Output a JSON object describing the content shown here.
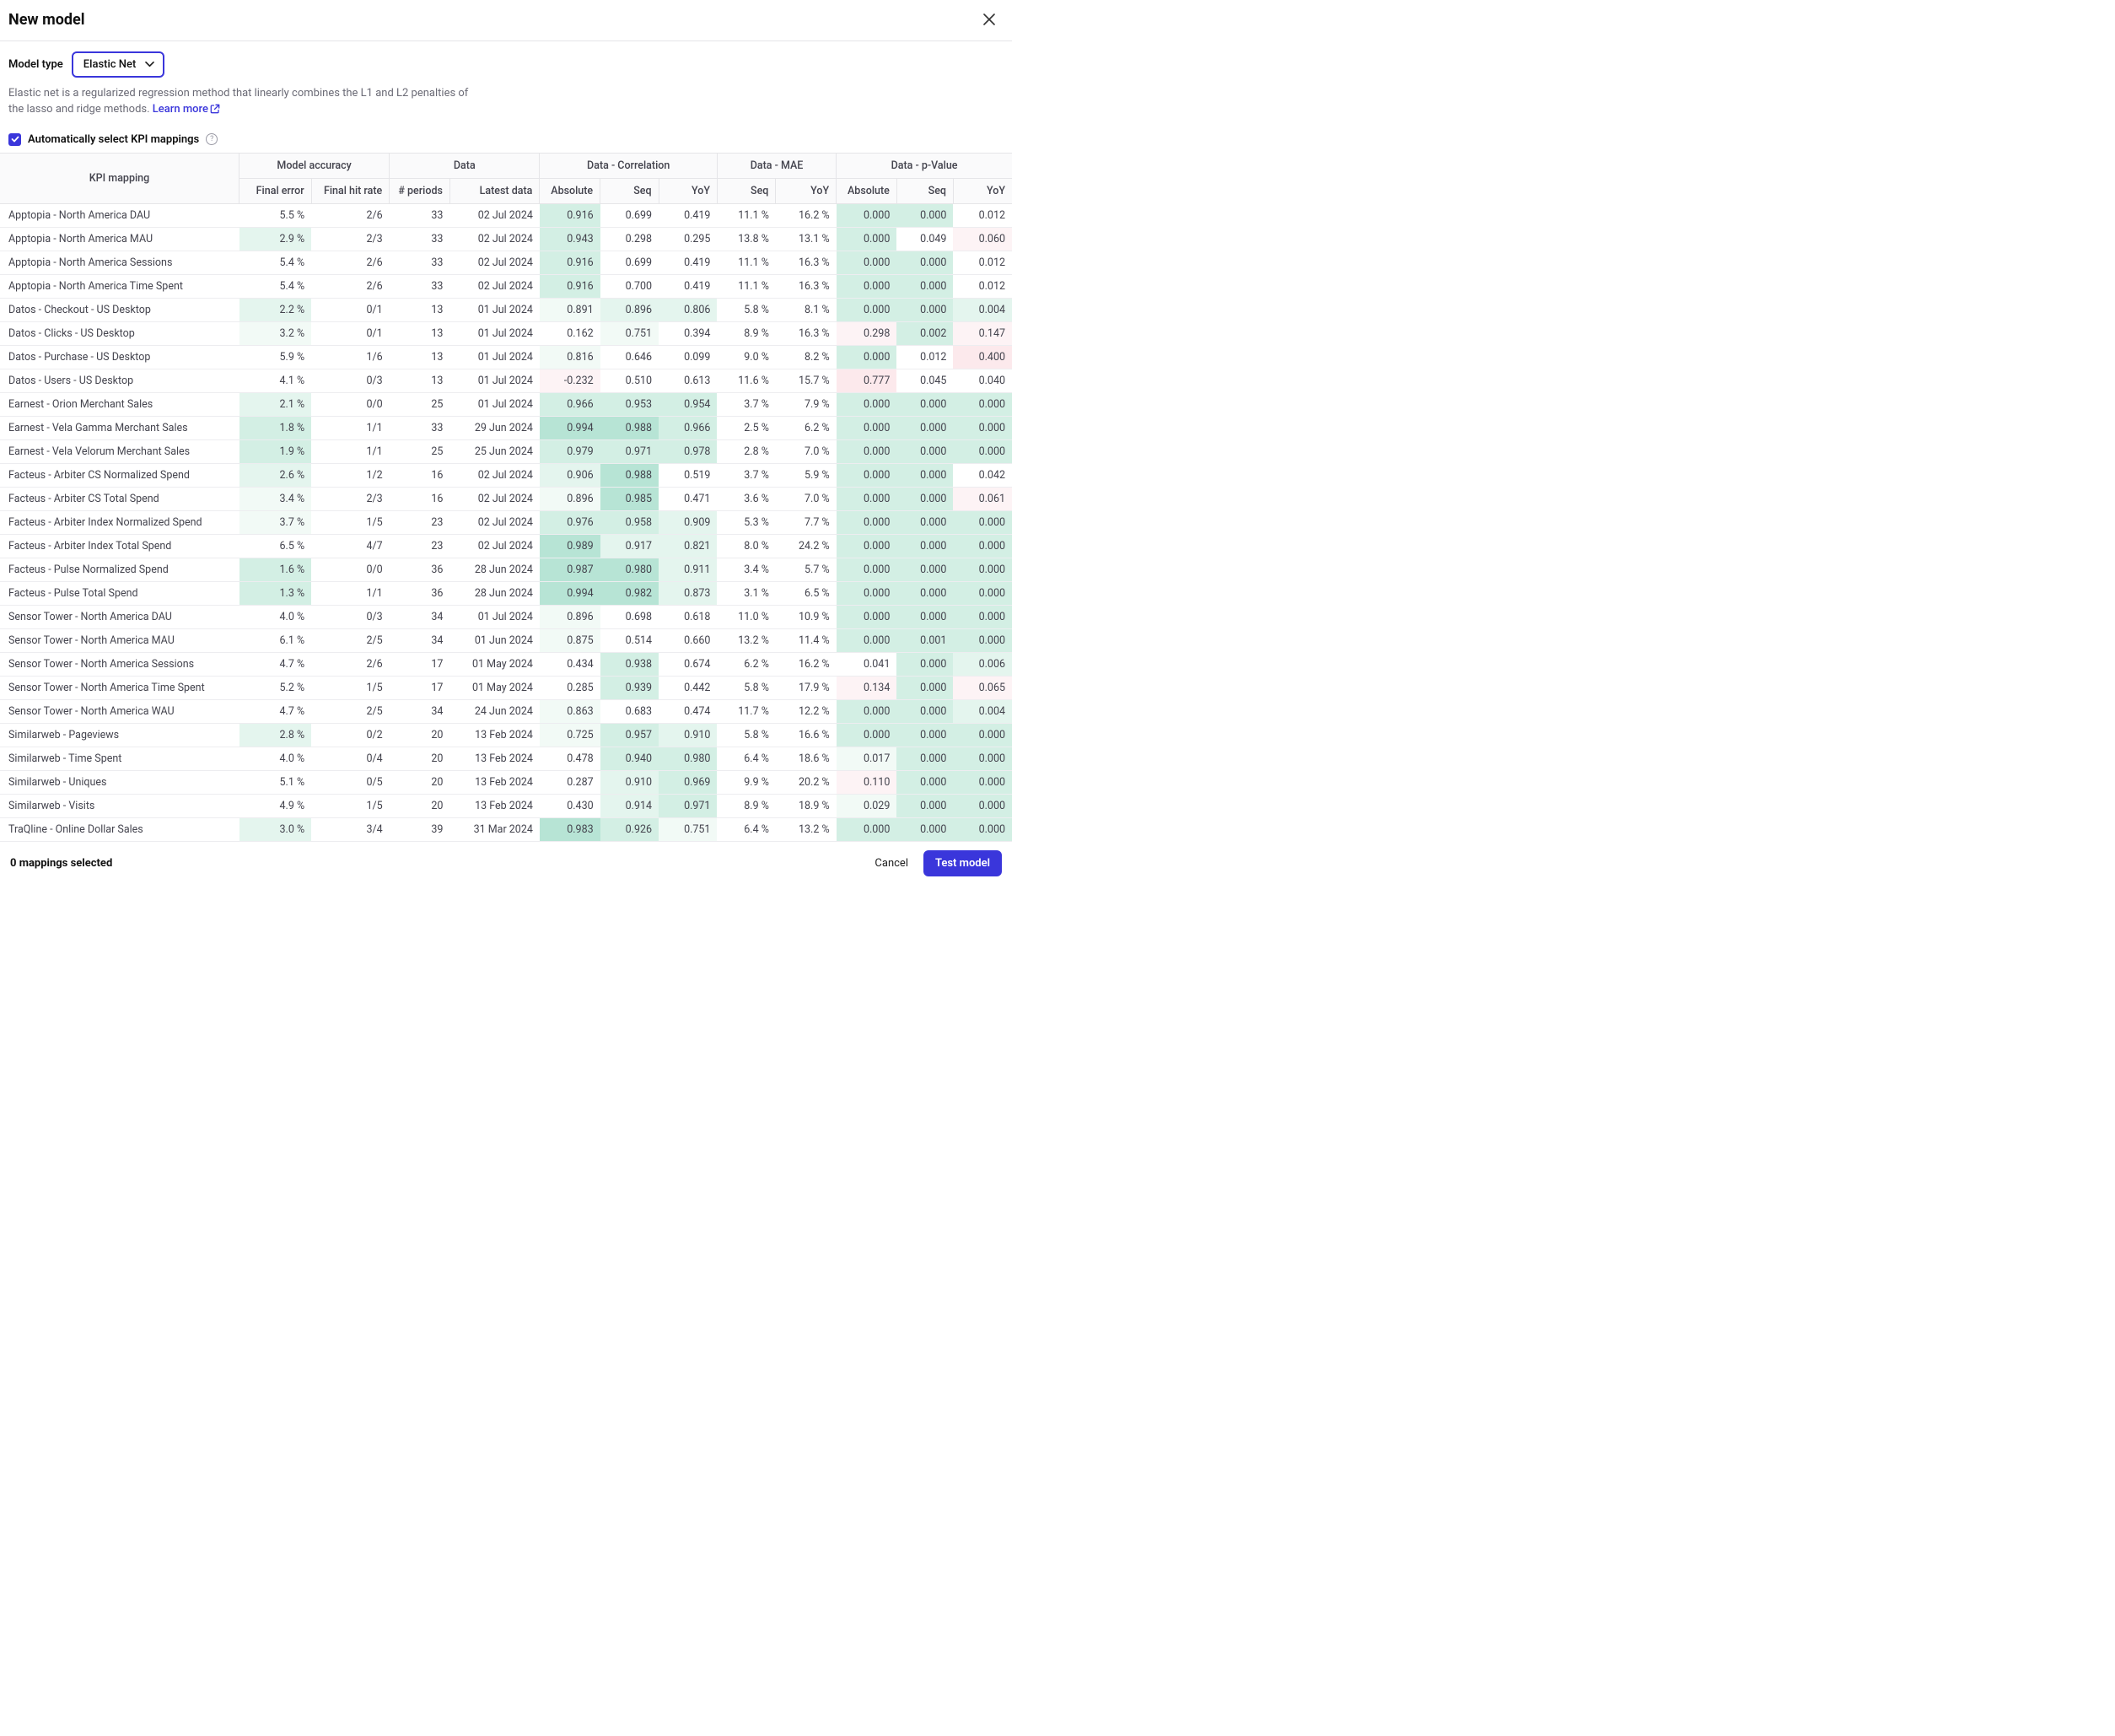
{
  "header": {
    "title": "New model"
  },
  "config": {
    "modeltype_label": "Model type",
    "modeltype_value": "Elastic Net",
    "description_prefix": "Elastic net is a regularized regression method that linearly combines the L1 and L2 penalties of the lasso and ridge methods. ",
    "learnmore": "Learn more",
    "auto_kpi_label": "Automatically select KPI mappings",
    "auto_kpi_checked": true
  },
  "table": {
    "groups": {
      "accuracy": "Model accuracy",
      "data": "Data",
      "corr": "Data - Correlation",
      "mae": "Data - MAE",
      "pval": "Data - p-Value"
    },
    "cols": {
      "kpi": "KPI mapping",
      "final_error": "Final error",
      "final_hit_rate": "Final hit rate",
      "n_periods": "# periods",
      "latest_data": "Latest data",
      "c_abs": "Absolute",
      "c_seq": "Seq",
      "c_yoy": "YoY",
      "m_seq": "Seq",
      "m_yoy": "YoY",
      "p_abs": "Absolute",
      "p_seq": "Seq",
      "p_yoy": "YoY"
    },
    "rows": [
      {
        "kpi": "Apptopia - North America DAU",
        "fe": "5.5 %",
        "fe_c": "",
        "fhr": "2/6",
        "np": "33",
        "ld": "02 Jul 2024",
        "ca": "0.916",
        "ca_c": "g3",
        "cs": "0.699",
        "cs_c": "",
        "cy": "0.419",
        "cy_c": "",
        "ms": "11.1 %",
        "my": "16.2 %",
        "pa": "0.000",
        "pa_c": "g3",
        "ps": "0.000",
        "ps_c": "g3",
        "py": "0.012",
        "py_c": ""
      },
      {
        "kpi": "Apptopia - North America MAU",
        "fe": "2.9 %",
        "fe_c": "g2",
        "fhr": "2/3",
        "np": "33",
        "ld": "02 Jul 2024",
        "ca": "0.943",
        "ca_c": "g3",
        "cs": "0.298",
        "cs_c": "",
        "cy": "0.295",
        "cy_c": "",
        "ms": "13.8 %",
        "my": "13.1 %",
        "pa": "0.000",
        "pa_c": "g3",
        "ps": "0.049",
        "ps_c": "",
        "py": "0.060",
        "py_c": "r1"
      },
      {
        "kpi": "Apptopia - North America Sessions",
        "fe": "5.4 %",
        "fe_c": "",
        "fhr": "2/6",
        "np": "33",
        "ld": "02 Jul 2024",
        "ca": "0.916",
        "ca_c": "g3",
        "cs": "0.699",
        "cs_c": "",
        "cy": "0.419",
        "cy_c": "",
        "ms": "11.1 %",
        "my": "16.3 %",
        "pa": "0.000",
        "pa_c": "g3",
        "ps": "0.000",
        "ps_c": "g3",
        "py": "0.012",
        "py_c": ""
      },
      {
        "kpi": "Apptopia - North America Time Spent",
        "fe": "5.4 %",
        "fe_c": "",
        "fhr": "2/6",
        "np": "33",
        "ld": "02 Jul 2024",
        "ca": "0.916",
        "ca_c": "g3",
        "cs": "0.700",
        "cs_c": "",
        "cy": "0.419",
        "cy_c": "",
        "ms": "11.1 %",
        "my": "16.3 %",
        "pa": "0.000",
        "pa_c": "g3",
        "ps": "0.000",
        "ps_c": "g3",
        "py": "0.012",
        "py_c": ""
      },
      {
        "kpi": "Datos - Checkout - US Desktop",
        "fe": "2.2 %",
        "fe_c": "g2",
        "fhr": "0/1",
        "np": "13",
        "ld": "01 Jul 2024",
        "ca": "0.891",
        "ca_c": "g1",
        "cs": "0.896",
        "cs_c": "g2",
        "cy": "0.806",
        "cy_c": "g2",
        "ms": "5.8 %",
        "my": "8.1 %",
        "pa": "0.000",
        "pa_c": "g3",
        "ps": "0.000",
        "ps_c": "g3",
        "py": "0.004",
        "py_c": "g2"
      },
      {
        "kpi": "Datos - Clicks - US Desktop",
        "fe": "3.2 %",
        "fe_c": "g1",
        "fhr": "0/1",
        "np": "13",
        "ld": "01 Jul 2024",
        "ca": "0.162",
        "ca_c": "",
        "cs": "0.751",
        "cs_c": "g1",
        "cy": "0.394",
        "cy_c": "",
        "ms": "8.9 %",
        "my": "16.3 %",
        "pa": "0.298",
        "pa_c": "r1",
        "ps": "0.002",
        "ps_c": "g3",
        "py": "0.147",
        "py_c": "r1"
      },
      {
        "kpi": "Datos - Purchase - US Desktop",
        "fe": "5.9 %",
        "fe_c": "",
        "fhr": "1/6",
        "np": "13",
        "ld": "01 Jul 2024",
        "ca": "0.816",
        "ca_c": "g1",
        "cs": "0.646",
        "cs_c": "",
        "cy": "0.099",
        "cy_c": "",
        "ms": "9.0 %",
        "my": "8.2 %",
        "pa": "0.000",
        "pa_c": "g3",
        "ps": "0.012",
        "ps_c": "",
        "py": "0.400",
        "py_c": "r2"
      },
      {
        "kpi": "Datos - Users - US Desktop",
        "fe": "4.1 %",
        "fe_c": "",
        "fhr": "0/3",
        "np": "13",
        "ld": "01 Jul 2024",
        "ca": "-0.232",
        "ca_c": "r1",
        "cs": "0.510",
        "cs_c": "",
        "cy": "0.613",
        "cy_c": "",
        "ms": "11.6 %",
        "my": "15.7 %",
        "pa": "0.777",
        "pa_c": "r2",
        "ps": "0.045",
        "ps_c": "",
        "py": "0.040",
        "py_c": ""
      },
      {
        "kpi": "Earnest - Orion Merchant Sales",
        "fe": "2.1 %",
        "fe_c": "g2",
        "fhr": "0/0",
        "np": "25",
        "ld": "01 Jul 2024",
        "ca": "0.966",
        "ca_c": "g3",
        "cs": "0.953",
        "cs_c": "g3",
        "cy": "0.954",
        "cy_c": "g3",
        "ms": "3.7 %",
        "my": "7.9 %",
        "pa": "0.000",
        "pa_c": "g3",
        "ps": "0.000",
        "ps_c": "g3",
        "py": "0.000",
        "py_c": "g3"
      },
      {
        "kpi": "Earnest - Vela Gamma Merchant Sales",
        "fe": "1.8 %",
        "fe_c": "g3",
        "fhr": "1/1",
        "np": "33",
        "ld": "29 Jun 2024",
        "ca": "0.994",
        "ca_c": "g5",
        "cs": "0.988",
        "cs_c": "g5",
        "cy": "0.966",
        "cy_c": "g3",
        "ms": "2.5 %",
        "my": "6.2 %",
        "pa": "0.000",
        "pa_c": "g3",
        "ps": "0.000",
        "ps_c": "g3",
        "py": "0.000",
        "py_c": "g3"
      },
      {
        "kpi": "Earnest - Vela Velorum Merchant Sales",
        "fe": "1.9 %",
        "fe_c": "g3",
        "fhr": "1/1",
        "np": "25",
        "ld": "25 Jun 2024",
        "ca": "0.979",
        "ca_c": "g3",
        "cs": "0.971",
        "cs_c": "g3",
        "cy": "0.978",
        "cy_c": "g3",
        "ms": "2.8 %",
        "my": "7.0 %",
        "pa": "0.000",
        "pa_c": "g3",
        "ps": "0.000",
        "ps_c": "g3",
        "py": "0.000",
        "py_c": "g3"
      },
      {
        "kpi": "Facteus - Arbiter CS Normalized Spend",
        "fe": "2.6 %",
        "fe_c": "g2",
        "fhr": "1/2",
        "np": "16",
        "ld": "02 Jul 2024",
        "ca": "0.906",
        "ca_c": "g2",
        "cs": "0.988",
        "cs_c": "g5",
        "cy": "0.519",
        "cy_c": "",
        "ms": "3.7 %",
        "my": "5.9 %",
        "pa": "0.000",
        "pa_c": "g3",
        "ps": "0.000",
        "ps_c": "g3",
        "py": "0.042",
        "py_c": ""
      },
      {
        "kpi": "Facteus - Arbiter CS Total Spend",
        "fe": "3.4 %",
        "fe_c": "g1",
        "fhr": "2/3",
        "np": "16",
        "ld": "02 Jul 2024",
        "ca": "0.896",
        "ca_c": "g1",
        "cs": "0.985",
        "cs_c": "g5",
        "cy": "0.471",
        "cy_c": "",
        "ms": "3.6 %",
        "my": "7.0 %",
        "pa": "0.000",
        "pa_c": "g3",
        "ps": "0.000",
        "ps_c": "g3",
        "py": "0.061",
        "py_c": "r1"
      },
      {
        "kpi": "Facteus - Arbiter Index Normalized Spend",
        "fe": "3.7 %",
        "fe_c": "g1",
        "fhr": "1/5",
        "np": "23",
        "ld": "02 Jul 2024",
        "ca": "0.976",
        "ca_c": "g3",
        "cs": "0.958",
        "cs_c": "g3",
        "cy": "0.909",
        "cy_c": "g2",
        "ms": "5.3 %",
        "my": "7.7 %",
        "pa": "0.000",
        "pa_c": "g3",
        "ps": "0.000",
        "ps_c": "g3",
        "py": "0.000",
        "py_c": "g3"
      },
      {
        "kpi": "Facteus - Arbiter Index Total Spend",
        "fe": "6.5 %",
        "fe_c": "",
        "fhr": "4/7",
        "np": "23",
        "ld": "02 Jul 2024",
        "ca": "0.989",
        "ca_c": "g5",
        "cs": "0.917",
        "cs_c": "g2",
        "cy": "0.821",
        "cy_c": "g2",
        "ms": "8.0 %",
        "my": "24.2 %",
        "pa": "0.000",
        "pa_c": "g3",
        "ps": "0.000",
        "ps_c": "g3",
        "py": "0.000",
        "py_c": "g3"
      },
      {
        "kpi": "Facteus - Pulse Normalized Spend",
        "fe": "1.6 %",
        "fe_c": "g3",
        "fhr": "0/0",
        "np": "36",
        "ld": "28 Jun 2024",
        "ca": "0.987",
        "ca_c": "g5",
        "cs": "0.980",
        "cs_c": "g5",
        "cy": "0.911",
        "cy_c": "g2",
        "ms": "3.4 %",
        "my": "5.7 %",
        "pa": "0.000",
        "pa_c": "g3",
        "ps": "0.000",
        "ps_c": "g3",
        "py": "0.000",
        "py_c": "g3"
      },
      {
        "kpi": "Facteus - Pulse Total Spend",
        "fe": "1.3 %",
        "fe_c": "g3",
        "fhr": "1/1",
        "np": "36",
        "ld": "28 Jun 2024",
        "ca": "0.994",
        "ca_c": "g5",
        "cs": "0.982",
        "cs_c": "g5",
        "cy": "0.873",
        "cy_c": "g2",
        "ms": "3.1 %",
        "my": "6.5 %",
        "pa": "0.000",
        "pa_c": "g3",
        "ps": "0.000",
        "ps_c": "g3",
        "py": "0.000",
        "py_c": "g3"
      },
      {
        "kpi": "Sensor Tower - North America DAU",
        "fe": "4.0 %",
        "fe_c": "",
        "fhr": "0/3",
        "np": "34",
        "ld": "01 Jul 2024",
        "ca": "0.896",
        "ca_c": "g1",
        "cs": "0.698",
        "cs_c": "",
        "cy": "0.618",
        "cy_c": "",
        "ms": "11.0 %",
        "my": "10.9 %",
        "pa": "0.000",
        "pa_c": "g3",
        "ps": "0.000",
        "ps_c": "g3",
        "py": "0.000",
        "py_c": "g3"
      },
      {
        "kpi": "Sensor Tower - North America MAU",
        "fe": "6.1 %",
        "fe_c": "",
        "fhr": "2/5",
        "np": "34",
        "ld": "01 Jun 2024",
        "ca": "0.875",
        "ca_c": "g1",
        "cs": "0.514",
        "cs_c": "",
        "cy": "0.660",
        "cy_c": "",
        "ms": "13.2 %",
        "my": "11.4 %",
        "pa": "0.000",
        "pa_c": "g3",
        "ps": "0.001",
        "ps_c": "g3",
        "py": "0.000",
        "py_c": "g3"
      },
      {
        "kpi": "Sensor Tower - North America Sessions",
        "fe": "4.7 %",
        "fe_c": "",
        "fhr": "2/6",
        "np": "17",
        "ld": "01 May 2024",
        "ca": "0.434",
        "ca_c": "",
        "cs": "0.938",
        "cs_c": "g3",
        "cy": "0.674",
        "cy_c": "",
        "ms": "6.2 %",
        "my": "16.2 %",
        "pa": "0.041",
        "pa_c": "",
        "ps": "0.000",
        "ps_c": "g3",
        "py": "0.006",
        "py_c": "g2"
      },
      {
        "kpi": "Sensor Tower - North America Time Spent",
        "fe": "5.2 %",
        "fe_c": "",
        "fhr": "1/5",
        "np": "17",
        "ld": "01 May 2024",
        "ca": "0.285",
        "ca_c": "",
        "cs": "0.939",
        "cs_c": "g3",
        "cy": "0.442",
        "cy_c": "",
        "ms": "5.8 %",
        "my": "17.9 %",
        "pa": "0.134",
        "pa_c": "r1",
        "ps": "0.000",
        "ps_c": "g3",
        "py": "0.065",
        "py_c": "r1"
      },
      {
        "kpi": "Sensor Tower - North America WAU",
        "fe": "4.7 %",
        "fe_c": "",
        "fhr": "2/5",
        "np": "34",
        "ld": "24 Jun 2024",
        "ca": "0.863",
        "ca_c": "g1",
        "cs": "0.683",
        "cs_c": "",
        "cy": "0.474",
        "cy_c": "",
        "ms": "11.7 %",
        "my": "12.2 %",
        "pa": "0.000",
        "pa_c": "g3",
        "ps": "0.000",
        "ps_c": "g3",
        "py": "0.004",
        "py_c": "g2"
      },
      {
        "kpi": "Similarweb - Pageviews",
        "fe": "2.8 %",
        "fe_c": "g2",
        "fhr": "0/2",
        "np": "20",
        "ld": "13 Feb 2024",
        "ca": "0.725",
        "ca_c": "g1",
        "cs": "0.957",
        "cs_c": "g3",
        "cy": "0.910",
        "cy_c": "g2",
        "ms": "5.8 %",
        "my": "16.6 %",
        "pa": "0.000",
        "pa_c": "g3",
        "ps": "0.000",
        "ps_c": "g3",
        "py": "0.000",
        "py_c": "g3"
      },
      {
        "kpi": "Similarweb - Time Spent",
        "fe": "4.0 %",
        "fe_c": "",
        "fhr": "0/4",
        "np": "20",
        "ld": "13 Feb 2024",
        "ca": "0.478",
        "ca_c": "",
        "cs": "0.940",
        "cs_c": "g3",
        "cy": "0.980",
        "cy_c": "g3",
        "ms": "6.4 %",
        "my": "18.6 %",
        "pa": "0.017",
        "pa_c": "g1",
        "ps": "0.000",
        "ps_c": "g3",
        "py": "0.000",
        "py_c": "g3"
      },
      {
        "kpi": "Similarweb - Uniques",
        "fe": "5.1 %",
        "fe_c": "",
        "fhr": "0/5",
        "np": "20",
        "ld": "13 Feb 2024",
        "ca": "0.287",
        "ca_c": "",
        "cs": "0.910",
        "cs_c": "g2",
        "cy": "0.969",
        "cy_c": "g3",
        "ms": "9.9 %",
        "my": "20.2 %",
        "pa": "0.110",
        "pa_c": "r1",
        "ps": "0.000",
        "ps_c": "g3",
        "py": "0.000",
        "py_c": "g3"
      },
      {
        "kpi": "Similarweb - Visits",
        "fe": "4.9 %",
        "fe_c": "",
        "fhr": "1/5",
        "np": "20",
        "ld": "13 Feb 2024",
        "ca": "0.430",
        "ca_c": "",
        "cs": "0.914",
        "cs_c": "g2",
        "cy": "0.971",
        "cy_c": "g3",
        "ms": "8.9 %",
        "my": "18.9 %",
        "pa": "0.029",
        "pa_c": "g1",
        "ps": "0.000",
        "ps_c": "g3",
        "py": "0.000",
        "py_c": "g3"
      },
      {
        "kpi": "TraQline - Online Dollar Sales",
        "fe": "3.0 %",
        "fe_c": "g2",
        "fhr": "3/4",
        "np": "39",
        "ld": "31 Mar 2024",
        "ca": "0.983",
        "ca_c": "g5",
        "cs": "0.926",
        "cs_c": "g3",
        "cy": "0.751",
        "cy_c": "g1",
        "ms": "6.4 %",
        "my": "13.2 %",
        "pa": "0.000",
        "pa_c": "g3",
        "ps": "0.000",
        "ps_c": "g3",
        "py": "0.000",
        "py_c": "g3"
      }
    ]
  },
  "footer": {
    "selected": "0 mappings selected",
    "cancel": "Cancel",
    "test": "Test model"
  }
}
